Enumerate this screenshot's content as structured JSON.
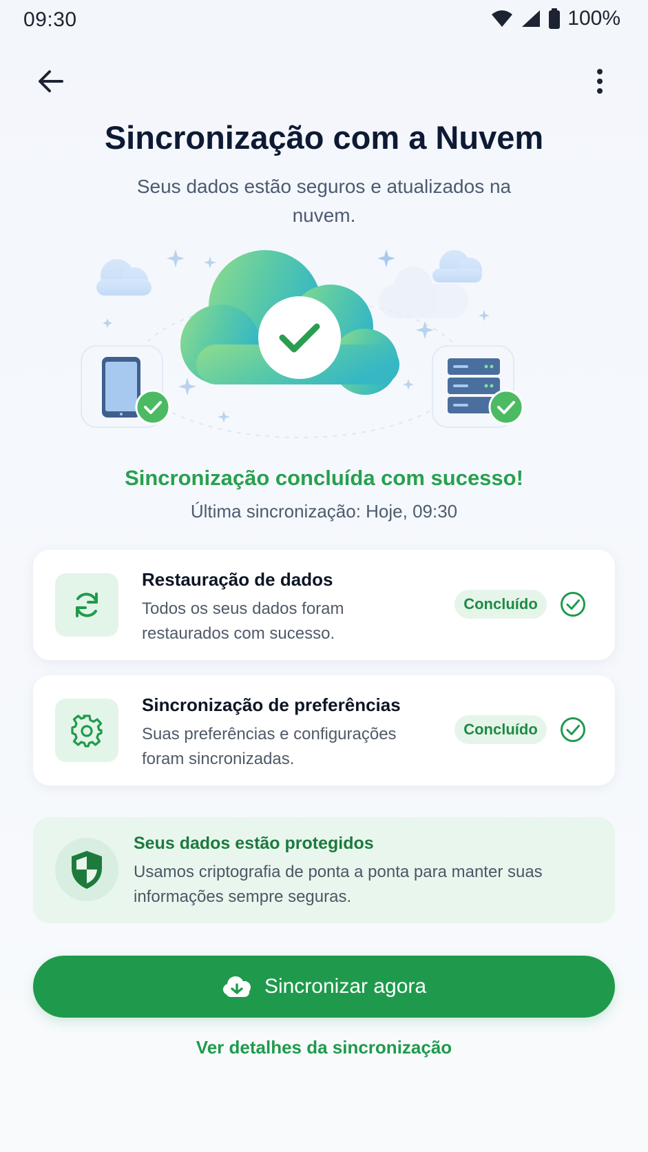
{
  "status_bar": {
    "time": "09:30",
    "battery": "100%",
    "icons": [
      "wifi-icon",
      "signal-icon",
      "battery-icon"
    ]
  },
  "header": {
    "back_icon": "arrow-left-icon",
    "more_icon": "more-vertical-icon"
  },
  "page": {
    "title": "Sincronização com a Nuvem",
    "subtitle": "Seus dados estão seguros e atualizados na nuvem."
  },
  "status": {
    "message": "Sincronização concluída com sucesso!",
    "last_sync": "Última sincronização: Hoje, 09:30"
  },
  "items": [
    {
      "icon": "refresh-icon",
      "title": "Restauração de dados",
      "description": "Todos os seus dados foram restaurados com sucesso.",
      "badge": "Concluído"
    },
    {
      "icon": "gear-icon",
      "title": "Sincronização de preferências",
      "description": "Suas preferências e configurações foram sincronizadas.",
      "badge": "Concluído"
    }
  ],
  "protection": {
    "icon": "shield-icon",
    "title": "Seus dados estão protegidos",
    "description": "Usamos criptografia de ponta a ponta para manter suas informações sempre seguras."
  },
  "actions": {
    "primary_label": "Sincronizar agora",
    "primary_icon": "cloud-sync-icon",
    "secondary_label": "Ver detalhes da sincronização"
  },
  "colors": {
    "accent": "#1f9a4c",
    "success_text": "#27a04f",
    "title": "#0e1a33"
  }
}
